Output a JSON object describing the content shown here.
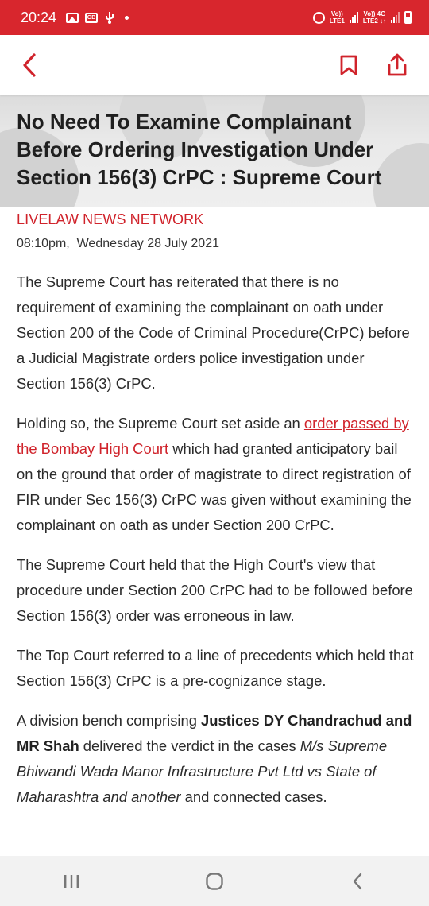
{
  "status_bar": {
    "time": "20:24",
    "sim1_label_top": "Vo))",
    "sim1_label_bottom": "LTE1",
    "sim2_label_top": "Vo)) 4G",
    "sim2_label_bottom": "LTE2 ↓↑",
    "icons": [
      "gallery-icon",
      "gb-badge-icon",
      "usb-icon",
      "dot-icon",
      "alarm-icon",
      "signal-icon",
      "battery-icon"
    ]
  },
  "app_bar": {
    "icons": [
      "back-icon",
      "bookmark-icon",
      "share-icon"
    ],
    "accent": "#d0232b"
  },
  "article": {
    "title": "No Need To Examine Complainant Before Ordering Investigation Under Section 156(3) CrPC : Supreme Court",
    "author": "LIVELAW NEWS NETWORK",
    "date": "08:10pm,  Wednesday 28 July 2021",
    "p1": "The Supreme Court has reiterated that there is no requirement of examining the complainant on oath under Section 200 of the Code of Criminal Procedure(CrPC) before a Judicial Magistrate orders police investigation under Section 156(3) CrPC.",
    "p2_pre": "Holding so, the Supreme Court set aside an ",
    "p2_link": "order passed by the Bombay High Court",
    "p2_post": " which had granted anticipatory bail on the ground that order of magistrate to direct registration of FIR under Sec 156(3) CrPC was given without examining the complainant on oath as under Section 200 CrPC.",
    "p3": "The Supreme Court held that the High Court's view that procedure under Section 200 CrPC had to be followed before Section 156(3) order was erroneous in law.",
    "p4": "The Top Court referred to a line of precedents which held that Section 156(3) CrPC is a pre-cognizance stage.",
    "p5_pre": "A division bench comprising ",
    "p5_bold": "Justices DY Chandrachud and MR Shah",
    "p5_mid": " delivered the verdict in the cases ",
    "p5_italic": "M/s Supreme Bhiwandi Wada Manor Infrastructure Pvt Ltd vs State of Maharashtra and another",
    "p5_post": " and connected cases."
  },
  "nav_bar": {
    "icons": [
      "recent-apps-icon",
      "home-icon",
      "back-nav-icon"
    ]
  }
}
